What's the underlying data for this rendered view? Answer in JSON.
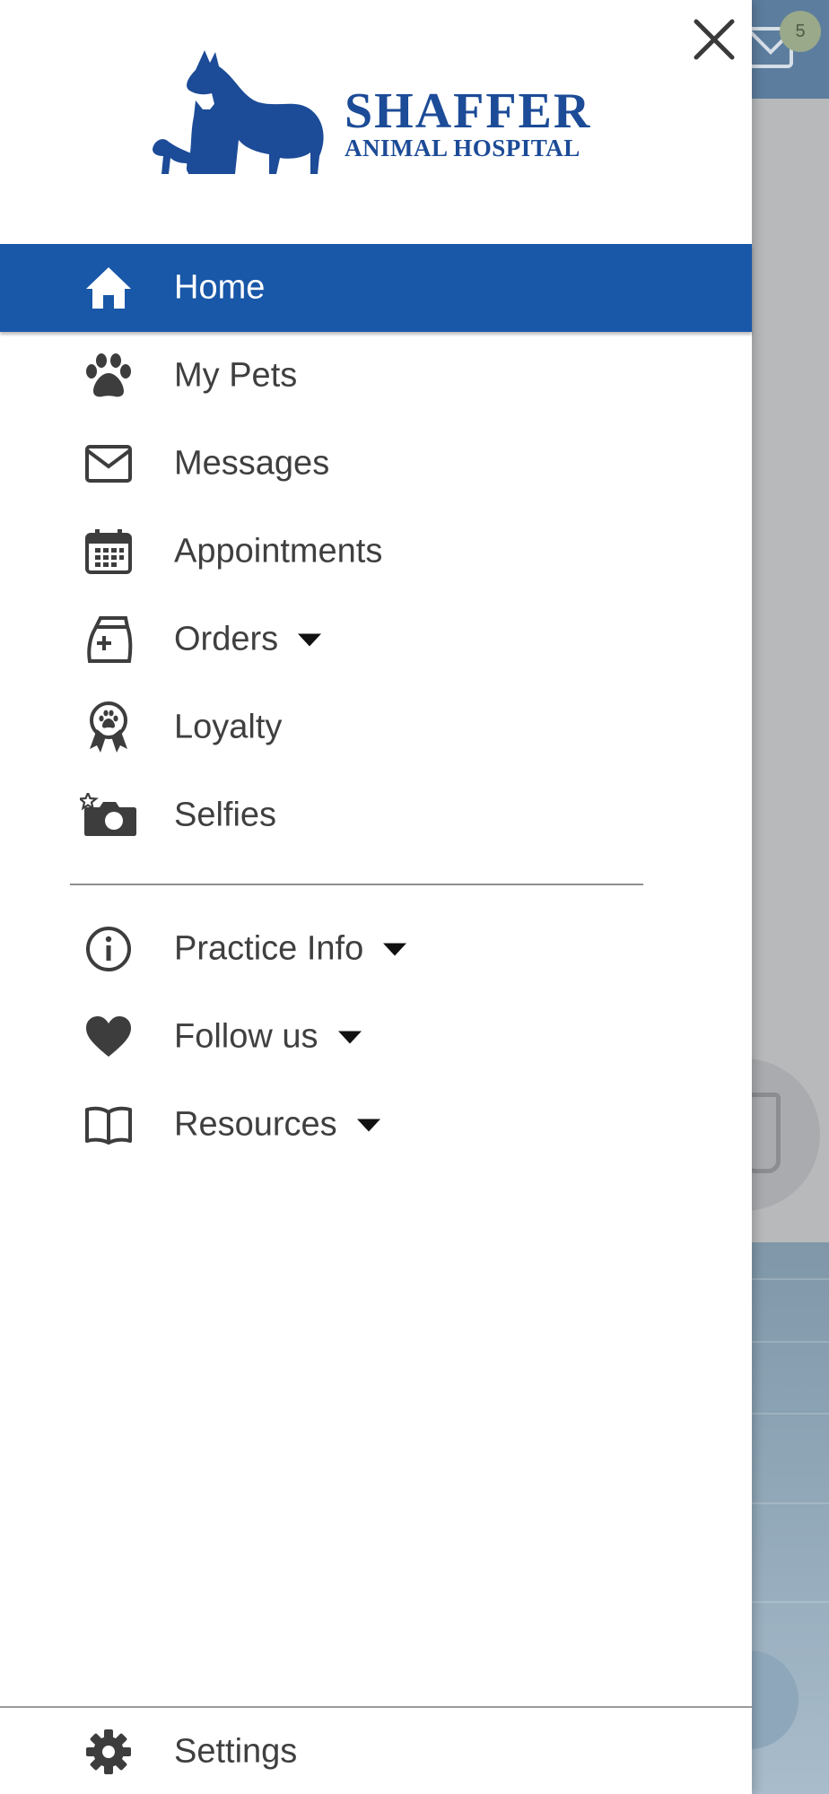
{
  "background": {
    "message_badge": "5"
  },
  "drawer": {
    "logo": {
      "line1": "SHAFFER",
      "line2": "ANIMAL HOSPITAL"
    },
    "nav": [
      {
        "label": "Home",
        "icon": "home-icon",
        "active": true
      },
      {
        "label": "My Pets",
        "icon": "paw-icon"
      },
      {
        "label": "Messages",
        "icon": "envelope-icon"
      },
      {
        "label": "Appointments",
        "icon": "calendar-icon"
      },
      {
        "label": "Orders",
        "icon": "pet-food-bag-icon",
        "dropdown": true
      },
      {
        "label": "Loyalty",
        "icon": "award-ribbon-icon"
      },
      {
        "label": "Selfies",
        "icon": "camera-icon"
      },
      {
        "label": "Practice Info",
        "icon": "info-icon",
        "dropdown": true
      },
      {
        "label": "Follow us",
        "icon": "heart-icon",
        "dropdown": true
      },
      {
        "label": "Resources",
        "icon": "book-icon",
        "dropdown": true
      }
    ],
    "settings": {
      "label": "Settings",
      "icon": "gear-icon"
    }
  },
  "colors": {
    "accent": "#1957a8",
    "logo": "#1c4b97",
    "text": "#3f3f3f",
    "icon": "#3d3d3d"
  }
}
